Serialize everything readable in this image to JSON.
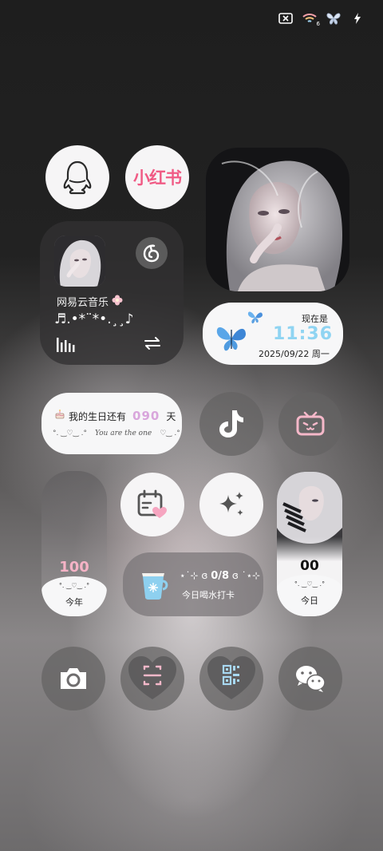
{
  "status_bar": {
    "icons": [
      "sim-off-icon",
      "wifi-icon",
      "butterfly-icon",
      "charging-icon"
    ],
    "wifi_label": "6"
  },
  "apps": {
    "qq": {
      "name": "qq-app-icon"
    },
    "xiaohongshu": {
      "label": "小红书"
    },
    "douyin": {
      "name": "douyin-app-icon"
    },
    "bilibili": {
      "name": "bilibili-app-icon"
    },
    "calendar": {
      "name": "calendar-heart-app-icon"
    },
    "sparkle": {
      "name": "sparkle-app-icon"
    },
    "camera": {
      "name": "camera-app-icon"
    },
    "scan": {
      "name": "scan-app-icon"
    },
    "qrcode": {
      "name": "qrcode-app-icon"
    },
    "wechat": {
      "name": "wechat-app-icon"
    }
  },
  "music_widget": {
    "title": "网易云音乐",
    "lyrics_deco": "♬.•*¨*•.¸¸♪",
    "controls": [
      "equalizer-icon",
      "switch-icon"
    ]
  },
  "time_widget": {
    "label": "现在是",
    "time": "11:36",
    "date": "2025/09/22 周一"
  },
  "birthday_widget": {
    "prefix": "我的生日还有",
    "days": "090",
    "suffix": "天",
    "deco_left": "°. ‿♡‿ .°",
    "script": "You are the one",
    "deco_right": "♡‿ .°"
  },
  "year_widget": {
    "count": "100",
    "deco": "°. ‿♡‿ .°",
    "label": "今年"
  },
  "water_widget": {
    "deco_left": "⋆˙⊹ ɞ",
    "count": "0/8",
    "deco_right": "ɞ ˙⋆⊹",
    "label": "今日喝水打卡"
  },
  "today_widget": {
    "count": "00",
    "deco": "°. ‿♡‿ .°",
    "label": "今日"
  }
}
